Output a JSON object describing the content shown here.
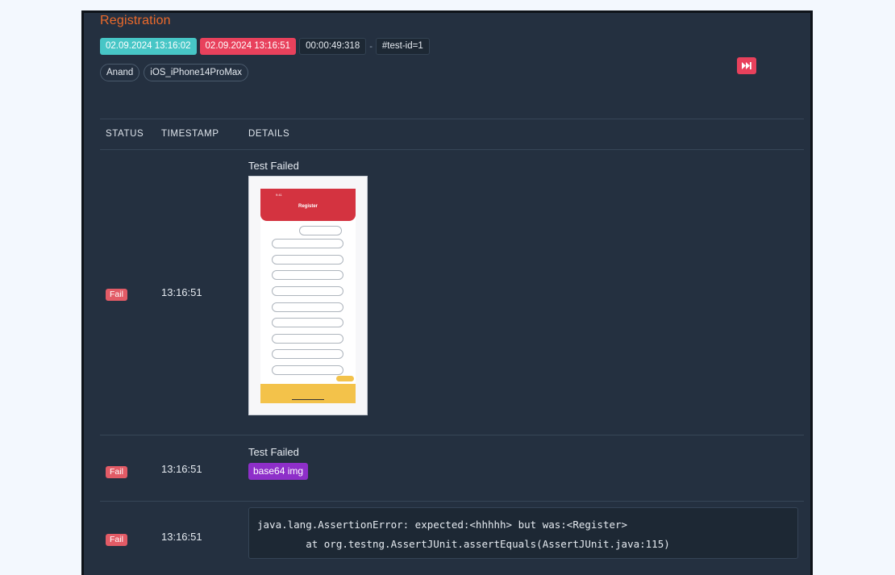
{
  "test": {
    "name": "Registration",
    "start_time": "02.09.2024 13:16:02",
    "end_time": "02.09.2024 13:16:51",
    "duration": "00:00:49:318",
    "separator": "-",
    "test_id": "#test-id=1",
    "author": "Anand",
    "device": "iOS_iPhone14ProMax"
  },
  "table": {
    "headers": [
      "STATUS",
      "TIMESTAMP",
      "DETAILS"
    ],
    "rows": [
      {
        "status": "Fail",
        "timestamp": "13:16:51",
        "details_title": "Test Failed",
        "screenshot_title": "Register"
      },
      {
        "status": "Fail",
        "timestamp": "13:16:51",
        "details_title": "Test Failed",
        "media_label": "base64 img"
      },
      {
        "status": "Fail",
        "timestamp": "13:16:51",
        "log": "java.lang.AssertionError: expected:<hhhhh> but was:<Register>\n        at org.testng.AssertJUnit.assertEquals(AssertJUnit.java:115)"
      }
    ]
  },
  "colors": {
    "accent": "#ec6a2b",
    "pass_start": "#47c6c6",
    "fail": "#e8415c",
    "media": "#8e2fc9",
    "panel": "#243040"
  },
  "icons": {
    "skip": "fast-forward-icon"
  }
}
